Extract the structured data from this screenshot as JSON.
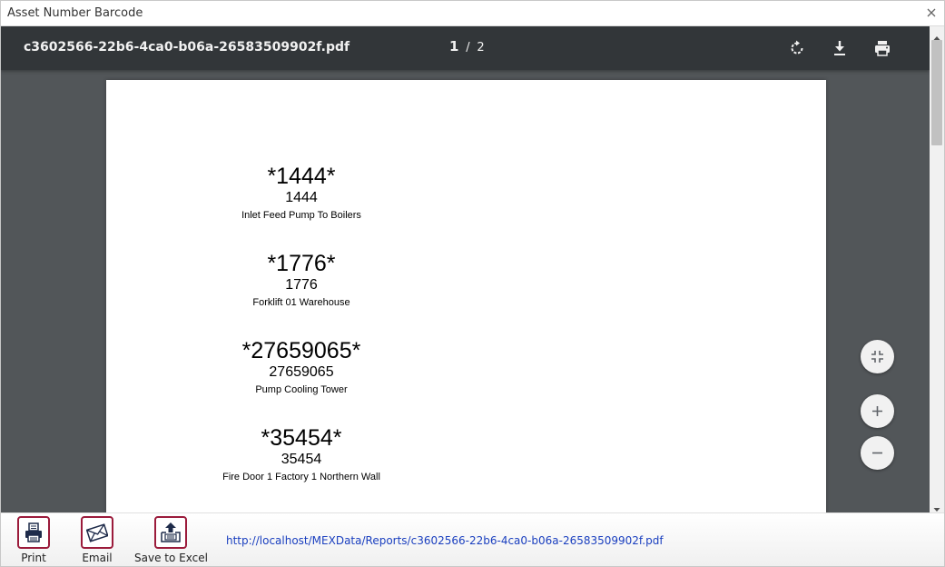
{
  "window": {
    "title": "Asset Number Barcode"
  },
  "viewer": {
    "filename": "c3602566-22b6-4ca0-b06a-26583509902f.pdf",
    "current_page": "1",
    "page_separator": "/",
    "total_pages": "2",
    "icons": [
      "rotate-icon",
      "download-icon",
      "print-icon",
      "fit-page-icon",
      "zoom-in-icon",
      "zoom-out-icon"
    ]
  },
  "assets": [
    {
      "barcode": "*1444*",
      "number": "1444",
      "description": "Inlet Feed Pump To Boilers"
    },
    {
      "barcode": "*1776*",
      "number": "1776",
      "description": "Forklift 01 Warehouse"
    },
    {
      "barcode": "*27659065*",
      "number": "27659065",
      "description": "Pump Cooling Tower"
    },
    {
      "barcode": "*35454*",
      "number": "35454",
      "description": "Fire Door 1 Factory 1 Northern Wall"
    }
  ],
  "footer": {
    "print_label": "Print",
    "email_label": "Email",
    "excel_label": "Save to Excel",
    "url": "http://localhost/MEXData/Reports/c3602566-22b6-4ca0-b06a-26583509902f.pdf"
  },
  "colors": {
    "toolbar": "#323639",
    "viewer_bg": "#525659",
    "accent": "#9b1b3b",
    "link": "#1a3fbf"
  }
}
